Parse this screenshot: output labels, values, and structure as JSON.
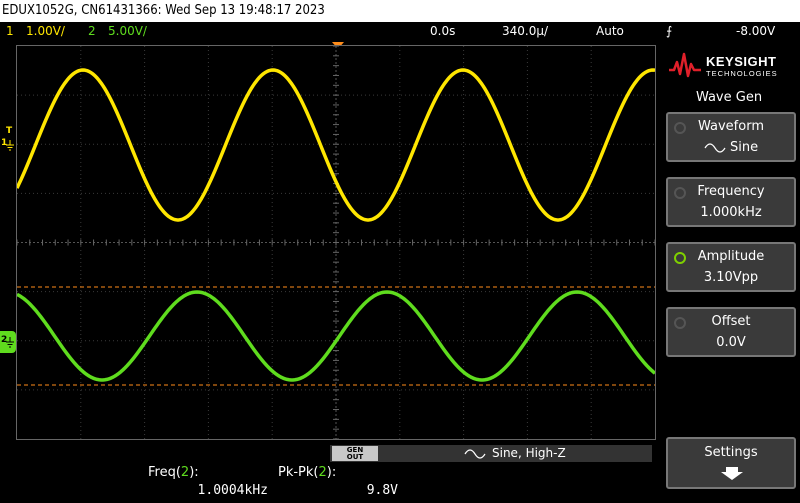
{
  "titlebar": {
    "text": "EDUX1052G, CN61431366: Wed Sep 13 19:48:17 2023"
  },
  "status": {
    "ch1_num": "1",
    "ch1_scale": "1.00V/",
    "ch2_num": "2",
    "ch2_scale": "5.00V/",
    "time_pos": "0.0s",
    "time_scale": "340.0µ/",
    "trigger_mode": "Auto",
    "trigger_level": "-8.00V"
  },
  "markers": {
    "trigger": "T",
    "ch1": "1",
    "ch2": "2"
  },
  "logo": {
    "brand": "KEYSIGHT",
    "sub": "TECHNOLOGIES"
  },
  "panel": {
    "title": "Wave Gen",
    "softkeys": [
      {
        "label": "Waveform",
        "value": "Sine"
      },
      {
        "label": "Frequency",
        "value": "1.000kHz"
      },
      {
        "label": "Amplitude",
        "value": "3.10Vpp"
      },
      {
        "label": "Offset",
        "value": "0.0V"
      }
    ],
    "settings": "Settings"
  },
  "wavegen_strip": {
    "genout": "GEN OUT",
    "text": "Sine, High-Z"
  },
  "measurements": [
    {
      "label_pre": "Freq(",
      "ch": "2",
      "label_post": "):",
      "value": "1.0004kHz"
    },
    {
      "label_pre": "Pk-Pk(",
      "ch": "2",
      "label_post": "):",
      "value": "9.8V"
    }
  ],
  "colors": {
    "ch1": "#ffe600",
    "ch2": "#5fdc1e",
    "trigger": "#ff8c1a"
  }
}
